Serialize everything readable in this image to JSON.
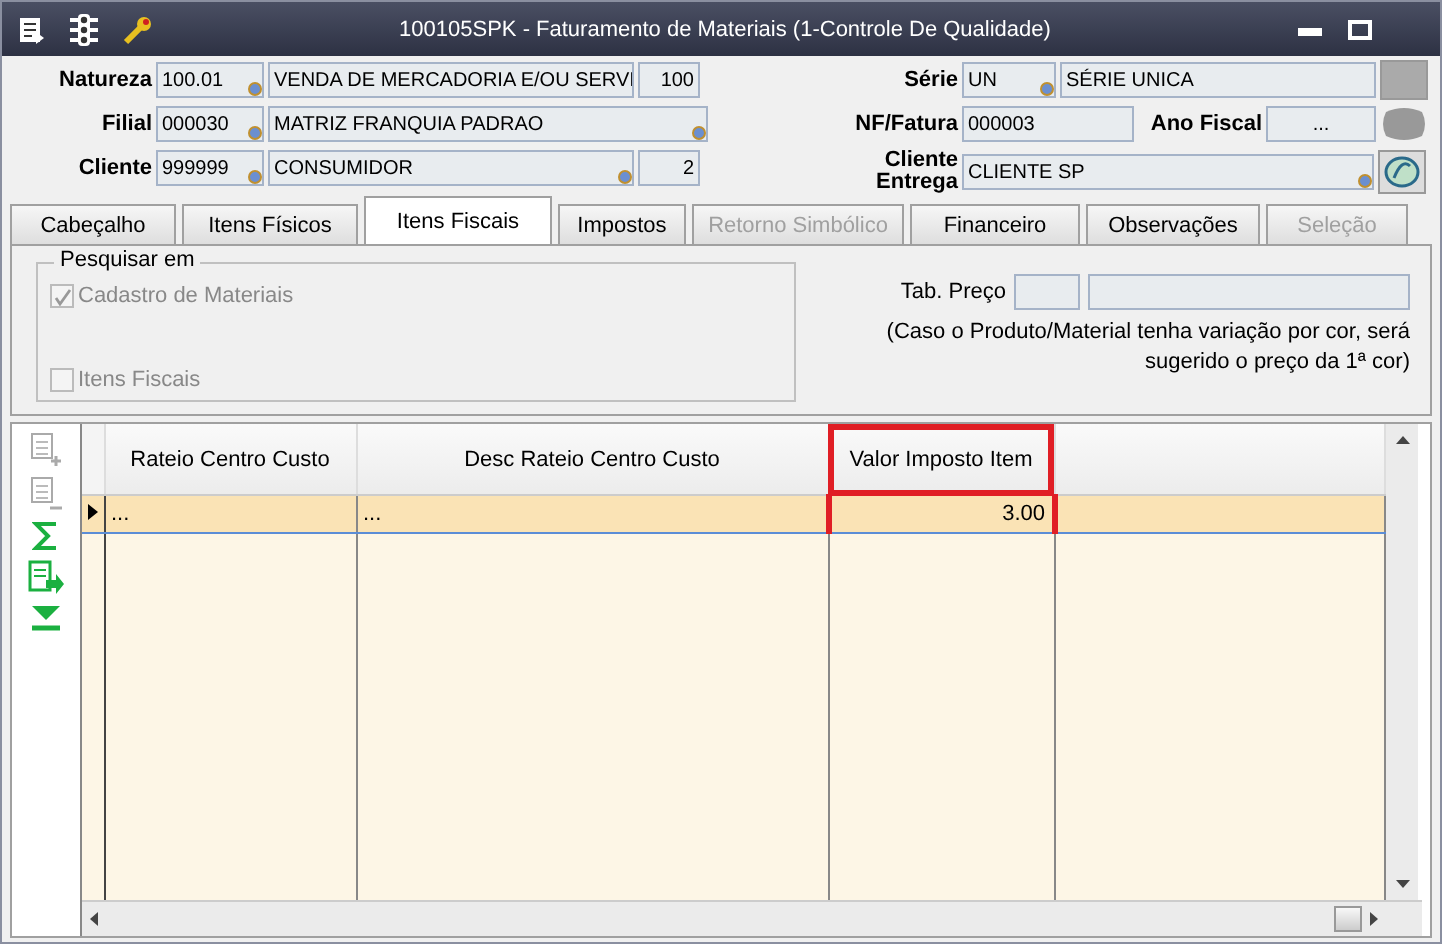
{
  "window": {
    "title": "100105SPK - Faturamento de Materiais (1-Controle De Qualidade)"
  },
  "header_left": [
    {
      "label": "Natureza",
      "code": "100.01",
      "description": "VENDA DE MERCADORIA E/OU SERVI",
      "number": "100"
    },
    {
      "label": "Filial",
      "code": "000030",
      "description": "MATRIZ FRANQUIA PADRAO"
    },
    {
      "label": "Cliente",
      "code": "999999",
      "description": "CONSUMIDOR",
      "number": "2"
    }
  ],
  "header_right": {
    "serie": {
      "label": "Série",
      "code": "UN",
      "description": "SÉRIE UNICA"
    },
    "nf_fatura": {
      "label": "NF/Fatura",
      "value": "000003"
    },
    "ano_fiscal": {
      "label": "Ano Fiscal",
      "value": "..."
    },
    "cliente_entrega": {
      "label": "Cliente Entrega",
      "value": "CLIENTE SP"
    }
  },
  "tabs": [
    {
      "label": "Cabeçalho",
      "selected": false,
      "disabled": false
    },
    {
      "label": "Itens Físicos",
      "selected": false,
      "disabled": false
    },
    {
      "label": "Itens Fiscais",
      "selected": true,
      "disabled": false
    },
    {
      "label": "Impostos",
      "selected": false,
      "disabled": false
    },
    {
      "label": "Retorno Simbólico",
      "selected": false,
      "disabled": true
    },
    {
      "label": "Financeiro",
      "selected": false,
      "disabled": false
    },
    {
      "label": "Observações",
      "selected": false,
      "disabled": false
    },
    {
      "label": "Seleção",
      "selected": false,
      "disabled": true
    }
  ],
  "search_group": {
    "title": "Pesquisar em",
    "options": [
      {
        "label": "Cadastro de Materiais",
        "checked": true,
        "disabled": true
      },
      {
        "label": "Itens Fiscais",
        "checked": false,
        "disabled": true
      }
    ]
  },
  "price_table": {
    "label": "Tab. Preço",
    "note": "(Caso o Produto/Material tenha variação por cor, será sugerido o preço da 1ª cor)"
  },
  "grid": {
    "columns": [
      {
        "label": "Rateio Centro Custo",
        "highlighted": false
      },
      {
        "label": "Desc Rateio Centro Custo",
        "highlighted": false
      },
      {
        "label": "Valor Imposto Item",
        "highlighted": true
      }
    ],
    "rows": [
      {
        "cells": [
          "...",
          "...",
          "3.00"
        ],
        "selected": true
      }
    ]
  }
}
